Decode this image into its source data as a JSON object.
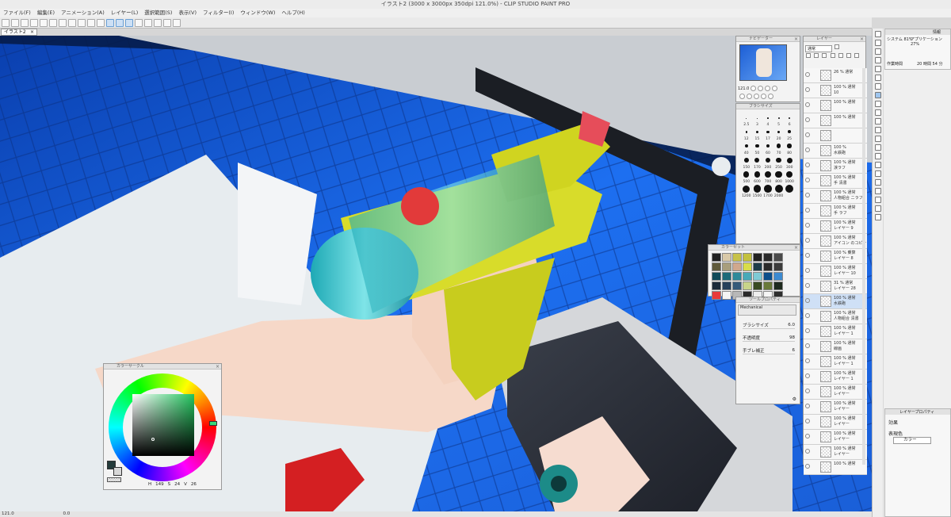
{
  "title": "イラスト2 (3000 x 3000px 350dpi 121.0%)  - CLIP STUDIO PAINT PRO",
  "menu": [
    "ファイル(F)",
    "編集(E)",
    "アニメーション(A)",
    "レイヤー(L)",
    "選択範囲(S)",
    "表示(V)",
    "フィルター(I)",
    "ウィンドウ(W)",
    "ヘルプ(H)"
  ],
  "doc_tab": {
    "label": "イラスト2",
    "close": "×"
  },
  "status": {
    "zoom": "121.0",
    "angle": "0.0"
  },
  "navigator": {
    "title": "ナビゲーター",
    "zoom": "121.0"
  },
  "brush_size": {
    "title": "ブラシサイズ",
    "rows": [
      [
        "2.5",
        "3",
        "4",
        "5",
        "6"
      ],
      [
        "",
        "",
        "",
        "",
        ""
      ],
      [
        "12",
        "15",
        "17",
        "20",
        "25"
      ],
      [
        "",
        "",
        "",
        "",
        ""
      ],
      [
        "40",
        "50",
        "60",
        "70",
        "80"
      ],
      [
        "",
        "",
        "",
        "",
        ""
      ],
      [
        "150",
        "170",
        "200",
        "250",
        "300"
      ],
      [
        "",
        "",
        "",
        "",
        ""
      ],
      [
        "500",
        "600",
        "700",
        "800",
        "1000"
      ],
      [
        "",
        "",
        "",
        "",
        ""
      ],
      [
        "1200",
        "1500",
        "1700",
        "2000",
        ""
      ]
    ]
  },
  "layers": {
    "title": "レイヤー",
    "blend": "通常",
    "items": [
      {
        "pct": "26 % 通常",
        "name": ""
      },
      {
        "pct": "100 % 通常",
        "name": "10"
      },
      {
        "pct": "100 % 通常",
        "name": ""
      },
      {
        "pct": "100 % 通常",
        "name": ""
      },
      {
        "pct": "",
        "name": ""
      },
      {
        "pct": "100 %",
        "name": "水鉄砲"
      },
      {
        "pct": "100 % 通常",
        "name": "涙ラフ"
      },
      {
        "pct": "100 % 通常",
        "name": "手 清書"
      },
      {
        "pct": "100 % 通常",
        "name": "人物組合 ニラフ"
      },
      {
        "pct": "100 % 通常",
        "name": "手 ラフ"
      },
      {
        "pct": "100 % 通常",
        "name": "レイヤー 9"
      },
      {
        "pct": "100 % 通常",
        "name": "アイコン のコピー"
      },
      {
        "pct": "100 % 乗算",
        "name": "レイヤー 8"
      },
      {
        "pct": "100 % 通常",
        "name": "レイヤー 10"
      },
      {
        "pct": "31 % 通常",
        "name": "レイヤー 28"
      },
      {
        "pct": "100 % 通常",
        "name": "水鉄砲"
      },
      {
        "pct": "100 % 通常",
        "name": "人物組合 清書"
      },
      {
        "pct": "100 % 通常",
        "name": "レイヤー 1"
      },
      {
        "pct": "100 % 通常",
        "name": "線画"
      },
      {
        "pct": "100 % 通常",
        "name": "レイヤー 1"
      },
      {
        "pct": "100 % 通常",
        "name": "レイヤー 1"
      },
      {
        "pct": "100 % 通常",
        "name": "レイヤー"
      },
      {
        "pct": "100 % 通常",
        "name": "レイヤー"
      },
      {
        "pct": "100 % 通常",
        "name": "レイヤー"
      },
      {
        "pct": "100 % 通常",
        "name": "レイヤー"
      },
      {
        "pct": "100 % 通常",
        "name": "レイヤー"
      },
      {
        "pct": "100 % 通常",
        "name": ""
      }
    ]
  },
  "color_set": {
    "title": "カラーセット",
    "colors": [
      "#222222",
      "#d9c9a8",
      "#c7c24a",
      "#c3c13e",
      "#222222",
      "#2a2a2a",
      "#4a4a4a",
      "#5f5a3a",
      "#a89e7c",
      "#d0a88d",
      "#d8dc4a",
      "#1e3d4a",
      "#2a2a2a",
      "#3b3b3b",
      "#0e4a5a",
      "#1c6a7a",
      "#2e8a9a",
      "#48aab8",
      "#7ecad5",
      "#0b4e8a",
      "#3c8ad0",
      "#1a2a3a",
      "#27405a",
      "#365a7a",
      "#c8d48a",
      "#3a4a22",
      "#6a7a3a",
      "#1e2a1e",
      "#e83a3a",
      "#f4f4f4",
      "#b8b8b8",
      "#2a2a2a",
      "#eeeeee",
      "#f5f5f5",
      "#2e2e2e"
    ]
  },
  "tool_property": {
    "title": "ツールプロパティ",
    "preset": "Mechanical",
    "rows": [
      {
        "label": "ブラシサイズ",
        "value": "6.0"
      },
      {
        "label": "不透明度",
        "value": "98"
      },
      {
        "label": "手ブレ補正",
        "value": "6"
      }
    ]
  },
  "color_wheel": {
    "title": "カラーサークル",
    "h": "149",
    "s": "24",
    "v": "26",
    "h_unit": "H",
    "s_unit": "S",
    "v_unit": "V"
  },
  "info": {
    "tab": "情報",
    "system": "システム 81%",
    "app": "アプリケーション 27%",
    "work_time_label": "作業時間",
    "work_time": "20 時間 54 分"
  },
  "layer_property": {
    "tab": "レイヤープロパティ",
    "effect": "効果",
    "display_color": "表現色",
    "display_value": "カラー"
  }
}
